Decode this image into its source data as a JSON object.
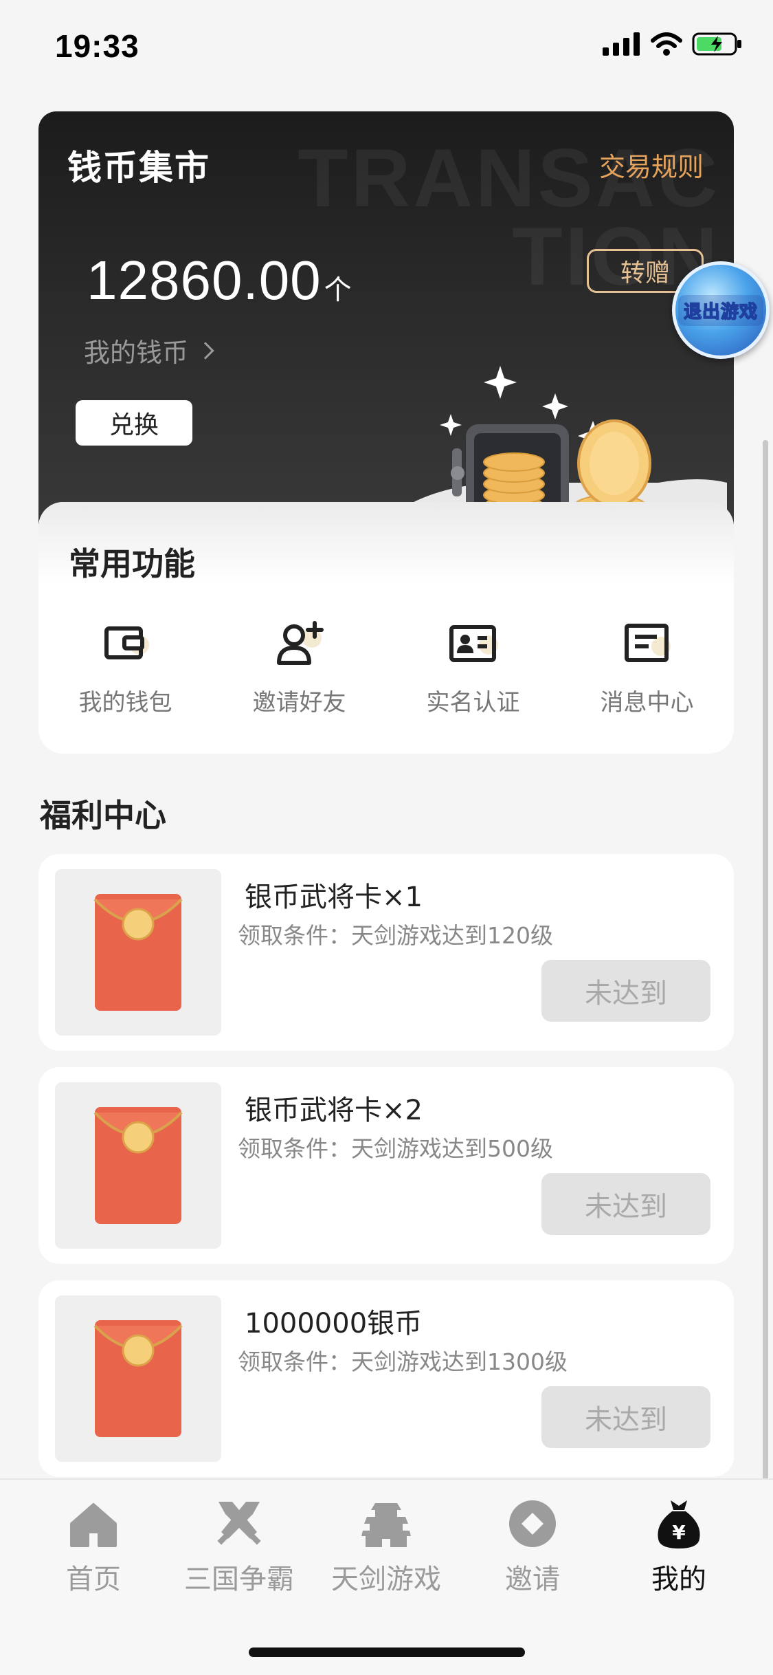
{
  "status_bar": {
    "time": "19:33"
  },
  "hero": {
    "title": "钱币集市",
    "watermark_line1": "TRANSAC",
    "watermark_line2": "TION",
    "rules_link": "交易规则",
    "balance": "12860.00",
    "balance_unit": "个",
    "my_coins_label": "我的钱币",
    "exchange_button": "兑换",
    "gift_button": "转赠"
  },
  "exit_game_badge": "退出游戏",
  "functions": {
    "title": "常用功能",
    "items": [
      {
        "label": "我的钱包",
        "icon": "wallet-icon"
      },
      {
        "label": "邀请好友",
        "icon": "add-friend-icon"
      },
      {
        "label": "实名认证",
        "icon": "id-card-icon"
      },
      {
        "label": "消息中心",
        "icon": "message-icon"
      }
    ]
  },
  "welfare": {
    "title": "福利中心",
    "items": [
      {
        "name": "银币武将卡×1",
        "condition": "领取条件：天剑游戏达到120级",
        "button": "未达到"
      },
      {
        "name": "银币武将卡×2",
        "condition": "领取条件：天剑游戏达到500级",
        "button": "未达到"
      },
      {
        "name": "1000000银币",
        "condition": "领取条件：天剑游戏达到1300级",
        "button": "未达到"
      }
    ]
  },
  "tabs": [
    {
      "label": "首页",
      "icon": "home-icon",
      "active": false
    },
    {
      "label": "三国争霸",
      "icon": "crossed-swords-icon",
      "active": false
    },
    {
      "label": "天剑游戏",
      "icon": "pagoda-icon",
      "active": false
    },
    {
      "label": "邀请",
      "icon": "invite-icon",
      "active": false
    },
    {
      "label": "我的",
      "icon": "money-bag-icon",
      "active": true
    }
  ],
  "colors": {
    "accent_gold": "#e6a35c",
    "card_red": "#e8654c",
    "coin_gold": "#f4c46a"
  }
}
